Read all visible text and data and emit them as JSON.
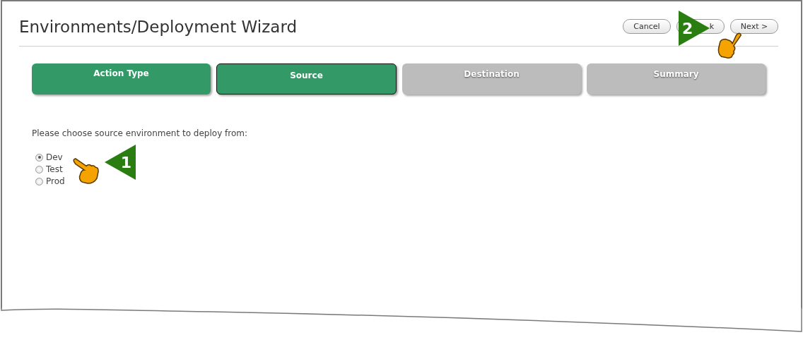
{
  "window": {
    "title": "Environments/Deployment Wizard"
  },
  "buttons": [
    {
      "label": "Cancel",
      "kind": "full"
    },
    {
      "label": "k",
      "kind": "covered"
    },
    {
      "label": "Next >",
      "kind": "full"
    }
  ],
  "steps": [
    {
      "label": "Action Type",
      "completed": true,
      "selected": false
    },
    {
      "label": "Source",
      "completed": false,
      "selected": true
    },
    {
      "label": "Destination",
      "completed": false,
      "selected": false
    },
    {
      "label": "Summary",
      "completed": false,
      "selected": false
    }
  ],
  "prompt": "Please choose source environment to deploy from:",
  "options": [
    {
      "label": "Dev",
      "selected": true
    },
    {
      "label": "Test",
      "selected": false
    },
    {
      "label": "Prod",
      "selected": false
    }
  ],
  "callouts": [
    {
      "number": "1",
      "kind": "left"
    },
    {
      "number": "2",
      "kind": "right"
    }
  ]
}
